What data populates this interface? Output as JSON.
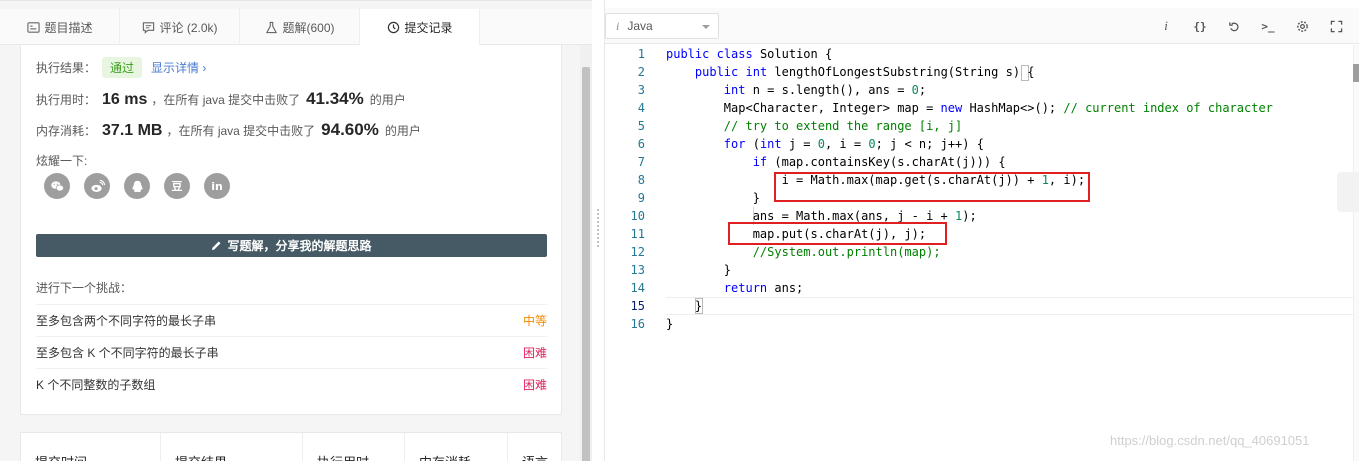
{
  "tabs": [
    {
      "label": "题目描述",
      "icon": "description-icon"
    },
    {
      "label": "评论 (2.0k)",
      "icon": "comment-icon"
    },
    {
      "label": "题解(600)",
      "icon": "flask-icon"
    },
    {
      "label": "提交记录",
      "icon": "clock-icon",
      "active": true
    }
  ],
  "result": {
    "label": "执行结果：",
    "status": "通过",
    "detail_link": "显示详情 ›"
  },
  "runtime": {
    "label": "执行用时：",
    "value": "16 ms",
    "middle": "，在所有 java 提交中击败了",
    "percent": "41.34%",
    "suffix": "的用户"
  },
  "memory": {
    "label": "内存消耗：",
    "value": "37.1 MB",
    "middle": "，在所有 java 提交中击败了",
    "percent": "94.60%",
    "suffix": "的用户"
  },
  "share": {
    "label": "炫耀一下:",
    "douban_glyph": "豆",
    "linkedin_glyph": "in"
  },
  "write_button": "写题解，分享我的解题思路",
  "next": {
    "title": "进行下一个挑战：",
    "items": [
      {
        "name": "至多包含两个不同字符的最长子串",
        "level": "中等",
        "kind": "medium"
      },
      {
        "name": "至多包含 K 个不同字符的最长子串",
        "level": "困难",
        "kind": "hard"
      },
      {
        "name": "K 个不同整数的子数组",
        "level": "困难",
        "kind": "hard"
      }
    ]
  },
  "table_headers": [
    "提交时间",
    "提交结果",
    "执行用时",
    "内存消耗",
    "语言"
  ],
  "editor": {
    "language_prefix": "i",
    "language": "Java",
    "tools": {
      "info": "i",
      "format": "{}",
      "console": ">_"
    },
    "line_numbers": [
      "1",
      "2",
      "3",
      "4",
      "5",
      "6",
      "7",
      "8",
      "9",
      "10",
      "11",
      "12",
      "13",
      "14",
      "15",
      "16"
    ]
  },
  "watermark": "https://blog.csdn.net/qq_40691051",
  "colors": {
    "pass_green": "#3c9e1a",
    "medium_orange": "#f08c00",
    "hard_red": "#e0245e",
    "button_slate": "#455a64",
    "highlight_red": "#e02020"
  }
}
